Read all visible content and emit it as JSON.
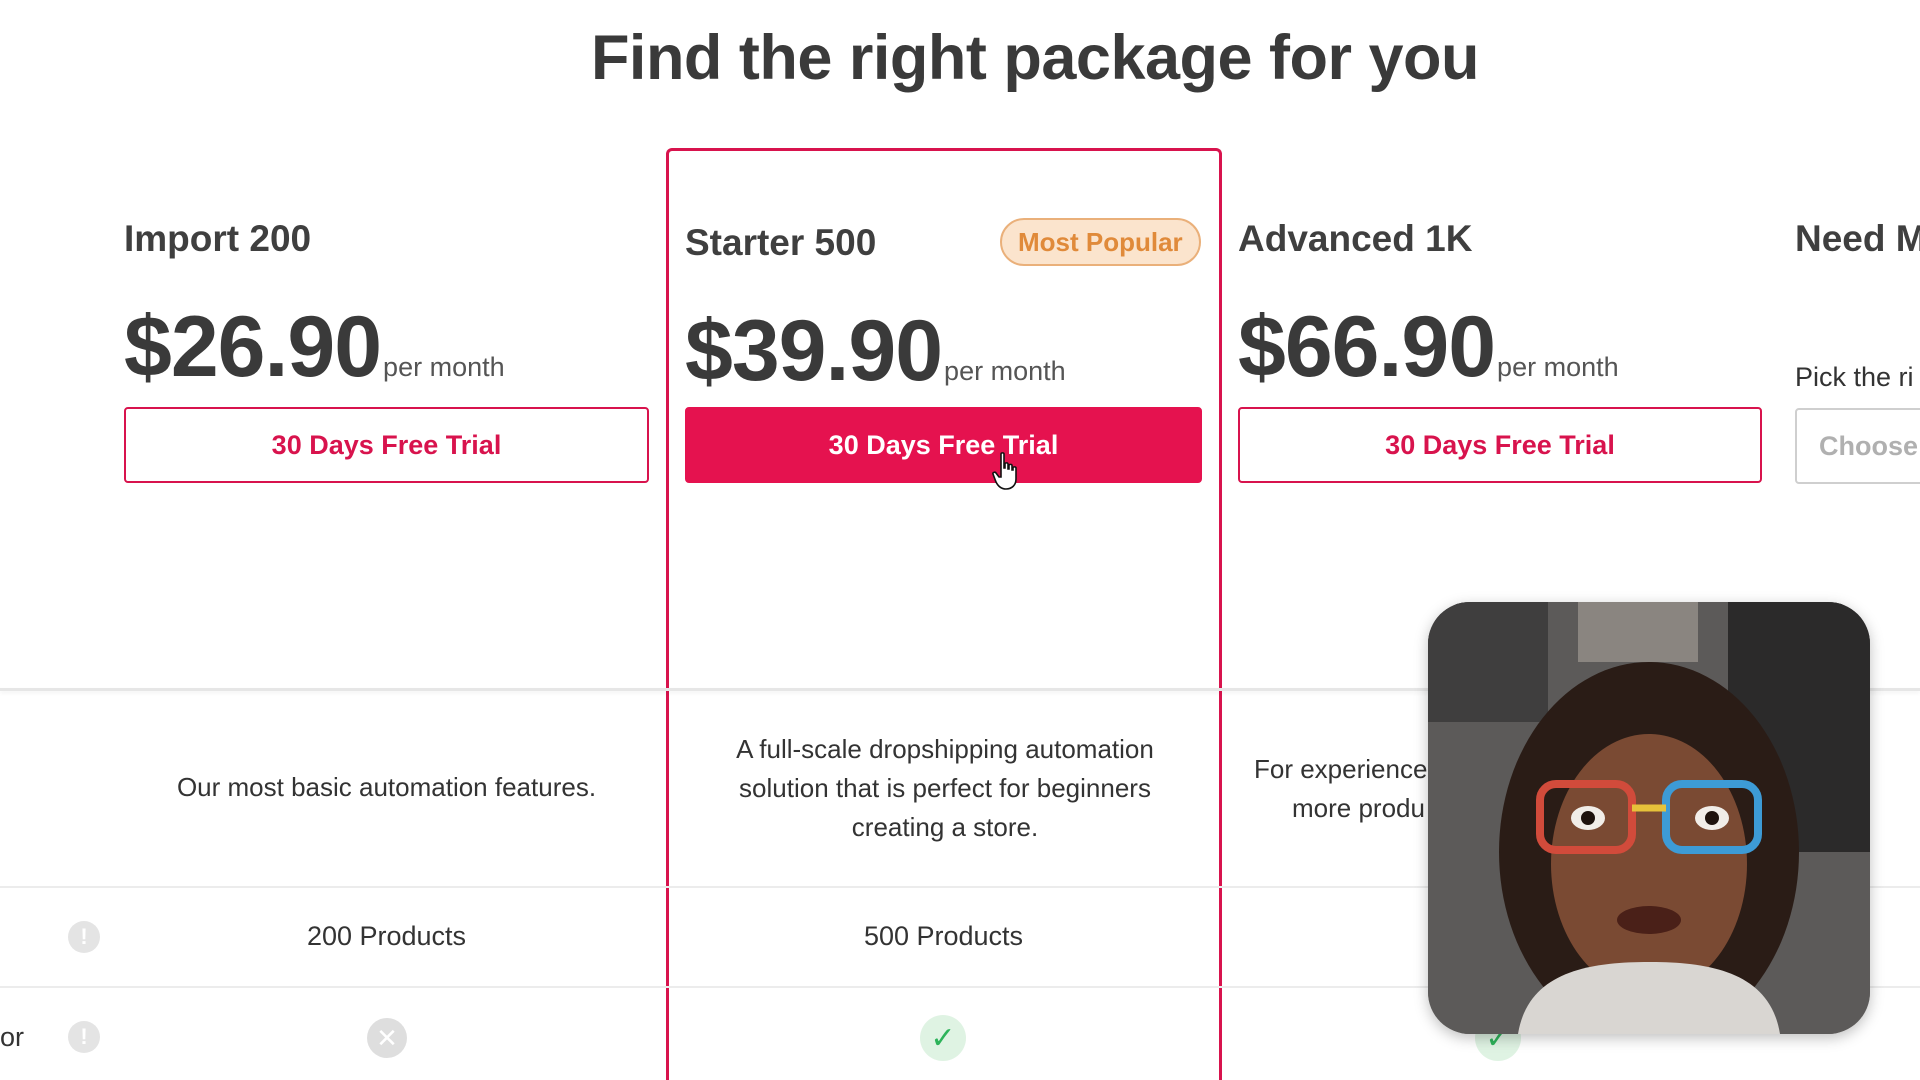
{
  "page": {
    "title": "Find the right package for you"
  },
  "plans": [
    {
      "name": "Import 200",
      "price": "$26.90",
      "period": "per month",
      "cta": "30 Days Free Trial",
      "description": "Our most basic automation features.",
      "products": "200 Products"
    },
    {
      "name": "Starter 500",
      "badge": "Most Popular",
      "price": "$39.90",
      "period": "per month",
      "cta": "30 Days Free Trial",
      "description": "A full-scale dropshipping automation solution that is perfect for beginners creating a store.",
      "products": "500 Products"
    },
    {
      "name": "Advanced 1K",
      "price": "$66.90",
      "period": "per month",
      "cta": "30 Days Free Trial",
      "description_line1": "For experience",
      "description_line2": "more produ"
    },
    {
      "name": "Need M",
      "subtitle": "Pick the ri",
      "cta": "Choose"
    }
  ],
  "rows": {
    "fragment_label": "or"
  },
  "icons": {
    "info": "info-icon",
    "x": "x-icon",
    "check": "check-icon",
    "cursor": "hand-cursor-icon"
  },
  "colors": {
    "accent": "#e5124f",
    "badge": "#e08a3a",
    "check": "#2db35a"
  }
}
